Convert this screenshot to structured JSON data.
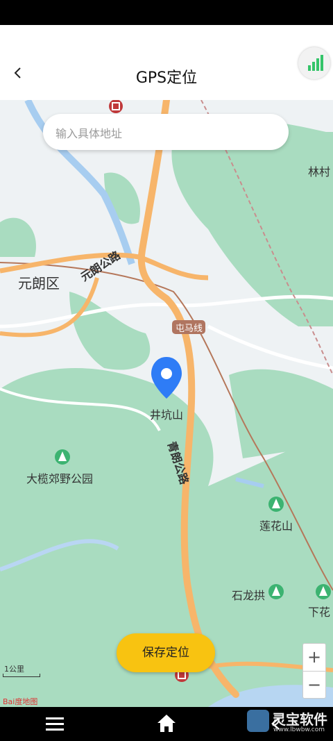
{
  "header": {
    "title": "GPS定位",
    "back_icon": "chevron-left-icon",
    "signal_icon": "signal-bars-icon"
  },
  "search": {
    "placeholder": "输入具体地址"
  },
  "map": {
    "labels": {
      "yuanlang_district": "元朗区",
      "yuanlang_road": "元朗公路",
      "tuenma_line": "屯马线",
      "jingkeng_shan": "井坑山",
      "qinglang_road": "青朗公路",
      "tailam_park": "大榄郊野公园",
      "lianhua_shan": "莲花山",
      "shilong_gong": "石龙拱",
      "xiahua": "下花",
      "lincun": "林村"
    },
    "scale": "1公里",
    "attribution": "Bai度地图"
  },
  "actions": {
    "save_label": "保存定位",
    "zoom_in": "+",
    "zoom_out": "−"
  },
  "watermark": {
    "name": "灵宝软件",
    "url": "www.lbwbw.com"
  },
  "colors": {
    "accent": "#f8c311",
    "pin": "#2e7cf6",
    "road": "#f7b56a",
    "green": "#a9dcc0"
  }
}
